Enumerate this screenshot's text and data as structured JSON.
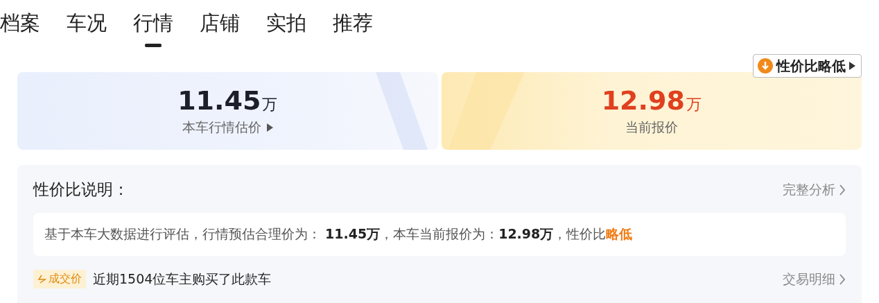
{
  "tabs": [
    {
      "label": "档案",
      "selected": false
    },
    {
      "label": "车况",
      "selected": false
    },
    {
      "label": "行情",
      "selected": true
    },
    {
      "label": "店铺",
      "selected": false
    },
    {
      "label": "实拍",
      "selected": false
    },
    {
      "label": "推荐",
      "selected": false
    }
  ],
  "badge": {
    "label": "性价比略低"
  },
  "prices": [
    {
      "kind": "estimate",
      "amount": "11.45",
      "unit": "万",
      "caption": "本车行情估价"
    },
    {
      "kind": "current",
      "amount": "12.98",
      "unit": "万",
      "caption": "当前报价"
    }
  ],
  "explanation": {
    "title": "性价比说明：",
    "link": "完整分析",
    "note": "基于本车大数据进行评估，行情预估合理价为： **11.45万**，本车当前报价为：**12.98万**，性价比**略低**"
  },
  "deals": {
    "tag": "成交价",
    "text": "近期1504位车主购买了此款车",
    "link": "交易明细"
  }
}
